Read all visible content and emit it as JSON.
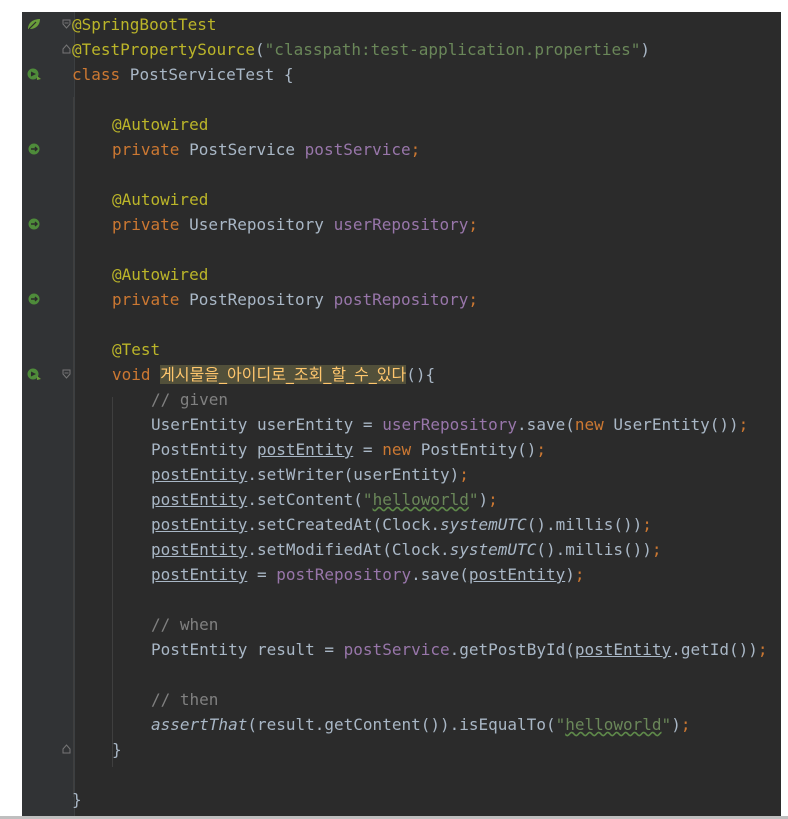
{
  "editor": {
    "colors": {
      "background": "#2b2b2b",
      "annotation": "#bbb529",
      "keyword": "#cc7832",
      "string": "#6a8759",
      "field": "#9876aa",
      "comment": "#808080",
      "text": "#a9b7c6",
      "method_highlight": "#ffc66d"
    },
    "lines": {
      "l1": {
        "t": "@SpringBootTest"
      },
      "l2": {
        "a": "@TestPropertySource",
        "b": "(",
        "c": "\"classpath:test-application.properties\"",
        "d": ")"
      },
      "l3": {
        "a": "class",
        "b": " PostServiceTest {"
      },
      "l5": {
        "t": "@Autowired"
      },
      "l6": {
        "a": "private",
        "b": " PostService ",
        "c": "postService",
        "d": ";"
      },
      "l8": {
        "t": "@Autowired"
      },
      "l9": {
        "a": "private",
        "b": " UserRepository ",
        "c": "userRepository",
        "d": ";"
      },
      "l11": {
        "t": "@Autowired"
      },
      "l12": {
        "a": "private",
        "b": " PostRepository ",
        "c": "postRepository",
        "d": ";"
      },
      "l14": {
        "t": "@Test"
      },
      "l15": {
        "a": "void",
        "b": " ",
        "c": "게시물을_아이디로_조회_할_수_있다",
        "d": "(){"
      },
      "l16": {
        "t": "// given"
      },
      "l17": {
        "a": "UserEntity userEntity = ",
        "b": "userRepository",
        "c": ".save(",
        "d": "new",
        "e": " UserEntity())",
        "f": ";"
      },
      "l18": {
        "a": "PostEntity ",
        "b": "postEntity",
        "c": " = ",
        "d": "new",
        "e": " PostEntity()",
        "f": ";"
      },
      "l19": {
        "a": "postEntity",
        "b": ".setWriter(userEntity)",
        "c": ";"
      },
      "l20": {
        "a": "postEntity",
        "b": ".setContent(",
        "c": "\"",
        "d": "helloworld",
        "e": "\"",
        "f": ")",
        "g": ";"
      },
      "l21": {
        "a": "postEntity",
        "b": ".setCreatedAt(Clock.",
        "c": "systemUTC",
        "d": "().millis())",
        "e": ";"
      },
      "l22": {
        "a": "postEntity",
        "b": ".setModifiedAt(Clock.",
        "c": "systemUTC",
        "d": "().millis())",
        "e": ";"
      },
      "l23": {
        "a": "postEntity",
        "b": " = ",
        "c": "postRepository",
        "d": ".save(",
        "e": "postEntity",
        "f": ")",
        "g": ";"
      },
      "l25": {
        "t": "// when"
      },
      "l26": {
        "a": "PostEntity result = ",
        "b": "postService",
        "c": ".getPostById(",
        "d": "postEntity",
        "e": ".getId())",
        "f": ";"
      },
      "l28": {
        "t": "// then"
      },
      "l29": {
        "a": "assertThat",
        "b": "(result.getContent()).isEqualTo(",
        "c": "\"",
        "d": "helloworld",
        "e": "\"",
        "f": ")",
        "g": ";"
      },
      "l30": {
        "t": "}"
      },
      "l32": {
        "t": "}"
      }
    }
  }
}
